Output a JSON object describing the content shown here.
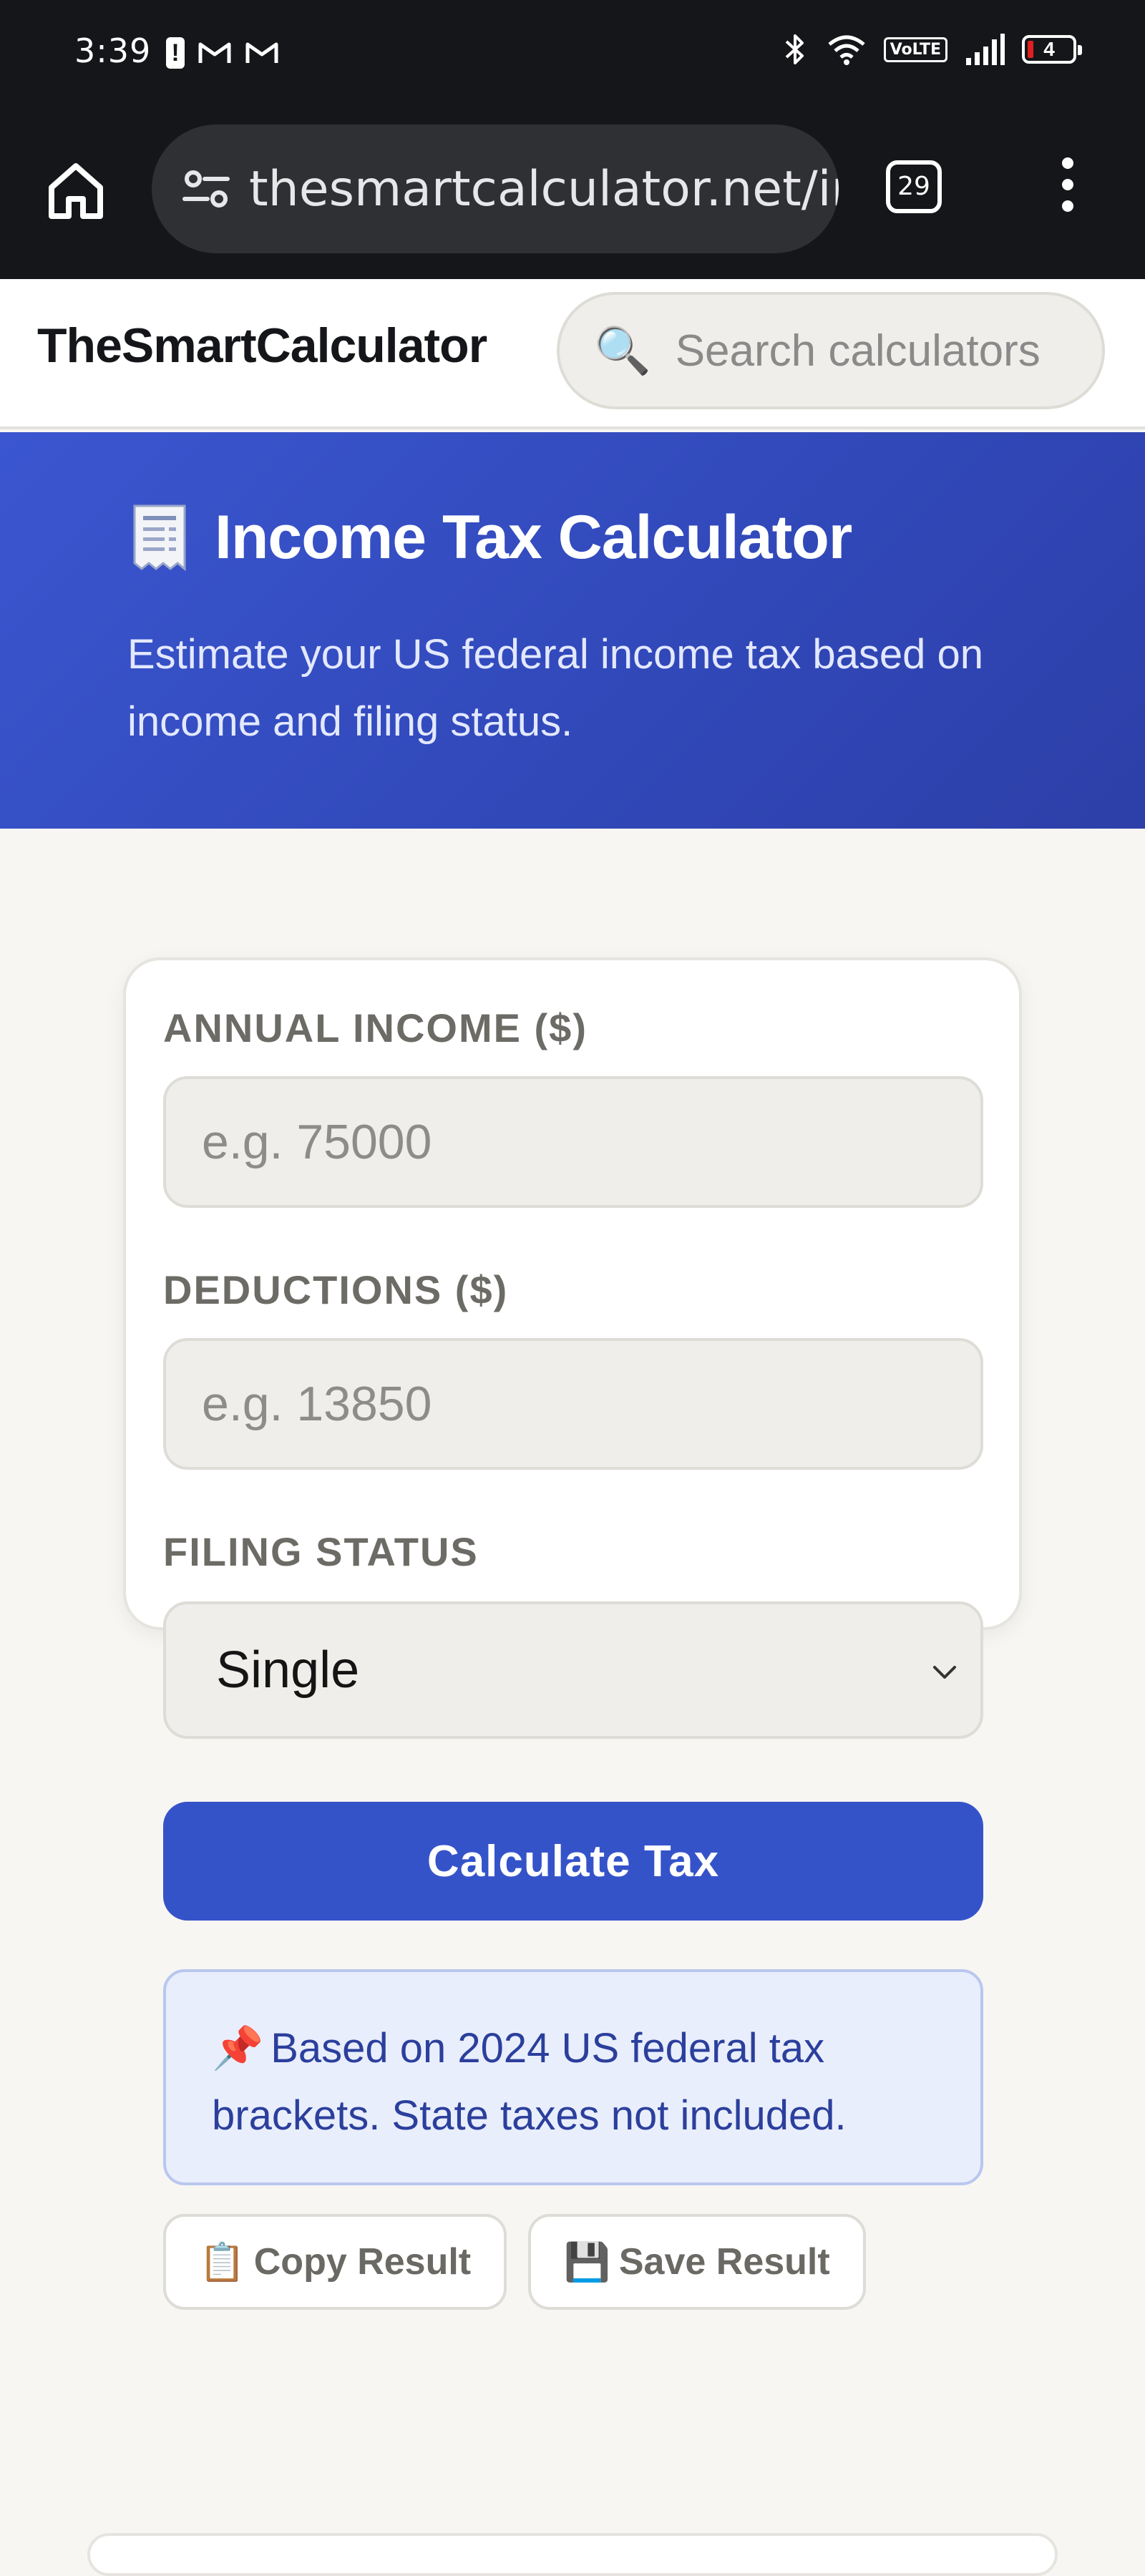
{
  "status_bar": {
    "time": "3:39",
    "volte": "VoLTE",
    "battery": "4"
  },
  "browser": {
    "url": "thesmartcalculator.net/ir",
    "tab_count": "29"
  },
  "site": {
    "logo": "TheSmartCalculator",
    "search_placeholder": "Search calculators"
  },
  "hero": {
    "title": "Income Tax Calculator",
    "subtitle": "Estimate your US federal income tax based on income and filing status."
  },
  "form": {
    "income_label": "ANNUAL INCOME ($)",
    "income_placeholder": "e.g. 75000",
    "deductions_label": "DEDUCTIONS ($)",
    "deductions_placeholder": "e.g. 13850",
    "filing_label": "FILING STATUS",
    "filing_value": "Single",
    "calculate_label": "Calculate Tax",
    "info_text": "Based on 2024 US federal tax brackets. State taxes not included.",
    "copy_label": "Copy Result",
    "save_label": "Save Result"
  },
  "icons": {
    "search": "🔍",
    "pin": "📌",
    "clipboard": "📋",
    "floppy": "💾"
  },
  "colors": {
    "accent": "#3553c9",
    "hero_bg": "#3149ba",
    "info_bg": "#e9eefc",
    "info_text": "#2b3f9c"
  }
}
